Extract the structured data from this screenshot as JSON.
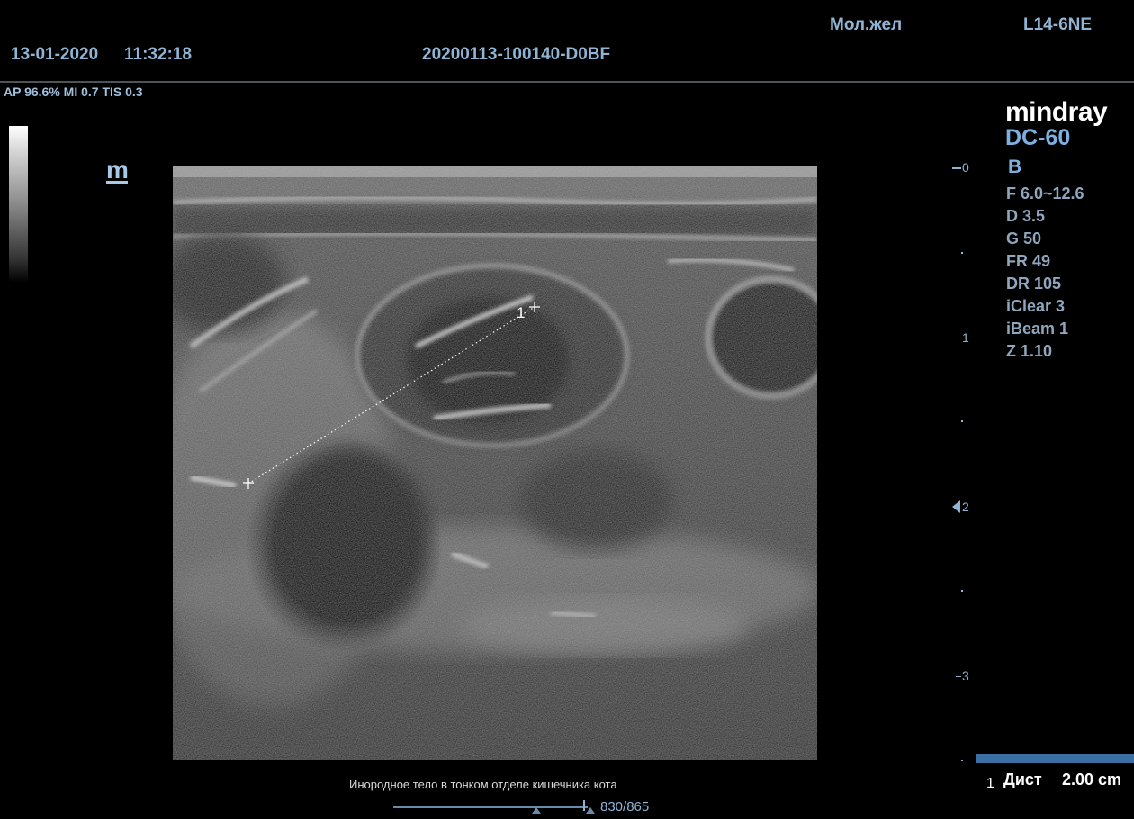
{
  "header": {
    "date": "13-01-2020",
    "time": "11:32:18",
    "study_id": "20200113-100140-D0BF",
    "preset": "Мол.жел",
    "probe": "L14-6NE",
    "acoustic_output": "AP 96.6%  MI 0.7 TIS 0.3"
  },
  "brand_logo": "m",
  "system": {
    "brand": "mindray",
    "model": "DC-60",
    "mode": "B",
    "params": [
      "F 6.0~12.6",
      "D 3.5",
      "G 50",
      "FR 49",
      "DR 105",
      "iClear 3",
      "iBeam 1",
      "Z 1.10"
    ]
  },
  "depth_scale": {
    "labels": [
      "0",
      "1",
      "2",
      "3"
    ],
    "focus_marker_label": "2"
  },
  "measurement": {
    "caliper_label": "1",
    "index": "1",
    "label": "Дист",
    "value": "2.00 cm"
  },
  "comment": "Инородное тело в тонком отделе кишечника кота",
  "cine": {
    "counter": "830/865",
    "position_fraction": 0.959
  },
  "colors": {
    "text_blue": "#8fb4d4",
    "accent_blue": "#7db0e0",
    "box_blue": "#3b6ea3"
  },
  "icons": [
    "grayscale-bar-icon",
    "mindray-m-icon",
    "focus-arrow-icon",
    "caliper-cross-icon",
    "cine-marker-icon"
  ]
}
